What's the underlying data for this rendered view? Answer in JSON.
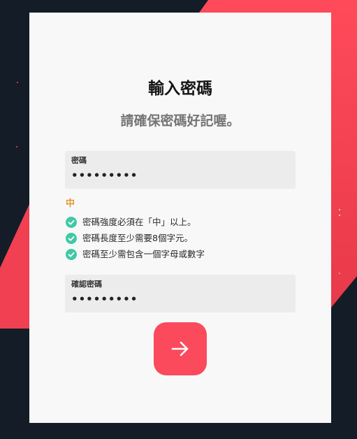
{
  "colors": {
    "background": "#141c27",
    "accent": "#fb4a5c",
    "card": "#f8f8f8",
    "check": "#3fc9a6",
    "strength": "#e3952e"
  },
  "form": {
    "title": "輸入密碼",
    "subtitle": "請確保密碼好記喔。",
    "password": {
      "label": "密碼",
      "value": "•••••••••"
    },
    "strength_label": "中",
    "rules": [
      {
        "text": "密碼強度必須在「中」以上。",
        "icon": "check-circle-icon",
        "status": "passed"
      },
      {
        "text": "密碼長度至少需要8個字元。",
        "icon": "check-circle-icon",
        "status": "passed"
      },
      {
        "text": "密碼至少需包含一個字母或數字",
        "icon": "check-circle-icon",
        "status": "passed"
      }
    ],
    "confirm": {
      "label": "確認密碼",
      "value": "•••••••••"
    },
    "submit_icon": "arrow-right-icon"
  }
}
